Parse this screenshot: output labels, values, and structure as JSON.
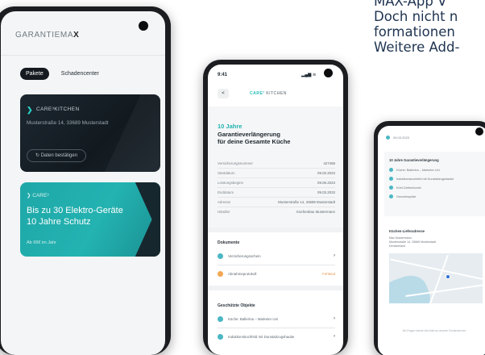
{
  "promo": {
    "line1": "MAX-App   V",
    "line2": "Doch nicht n",
    "line3": "formationen",
    "line4": "Weitere Add-"
  },
  "phone1": {
    "brand_prefix": "GARANTIEMA",
    "brand_suffix": "X",
    "tabs": [
      {
        "label": "Pakete",
        "active": true
      },
      {
        "label": "Schadencenter",
        "active": false
      }
    ],
    "card_dark": {
      "title": "CARE³KITCHEN",
      "address": "Musterstraße 14, 33689 Musterstadt",
      "button": "Daten bestätigen"
    },
    "card_teal": {
      "brand": "CARE³",
      "headline_1": "Bis zu 30 Elektro-Geräte",
      "headline_2": "10 Jahre Schutz",
      "price": "Ab 99€ im Jahr"
    },
    "colors": {
      "teal": "#23b3b1",
      "dark": "#141a1f"
    }
  },
  "phone2": {
    "time": "9:41",
    "signal": "..ll ⭘ ▮",
    "back": "<",
    "nav_title_prefix": "CARE³",
    "nav_title_suffix": "KITCHEN",
    "years": "10 Jahre",
    "headline_1": "Garantieverlängerung",
    "headline_2": "für deine Gesamte Küche",
    "details": [
      {
        "k": "Versicherungsnummer",
        "v": "427469"
      },
      {
        "k": "Startdatum",
        "v": "09.03.2023"
      },
      {
        "k": "Leistungsbeginn",
        "v": "09.06.2023"
      },
      {
        "k": "Enddatum",
        "v": "09.03.2033"
      },
      {
        "k": "Adresse",
        "v": "Musterstraße 14, 33689 Musterstadt"
      },
      {
        "k": "Händler",
        "v": "Küchenbau Mustermann"
      }
    ],
    "documents_title": "Dokumente",
    "documents": [
      {
        "label": "Versicherungsschein",
        "badge": "",
        "arrow": "›"
      },
      {
        "label": "Abnahmeprotokoll",
        "badge": "Fehlend",
        "arrow": ""
      }
    ],
    "objects_title": "Geschützte Objekte",
    "objects": [
      {
        "label": "Küche: Ballerina – Marketer Uni",
        "arrow": "›"
      },
      {
        "label": "Induktionskochfeld mit Dunstabzugshaube",
        "arrow": "›"
      }
    ]
  },
  "phone3": {
    "header_date": "09.03.2023",
    "box_title": "10 Jahre Garantieverlängerung",
    "items": [
      "Küche: Ballerina – Marketer Uni",
      "Induktionskochfeld mit Dunstabzugshaube",
      "Kühl-Gefrierkombi",
      "Geschirrspüler"
    ],
    "subtitle": "Küchen-Lieferadresse",
    "address_1": "Max Mustermann",
    "address_2": "Musterstraße 14, 33689 Musterstadt",
    "address_3": "Deutschland",
    "footer": "Bei Fragen wende dich bitte an unseren Kundenservice"
  }
}
